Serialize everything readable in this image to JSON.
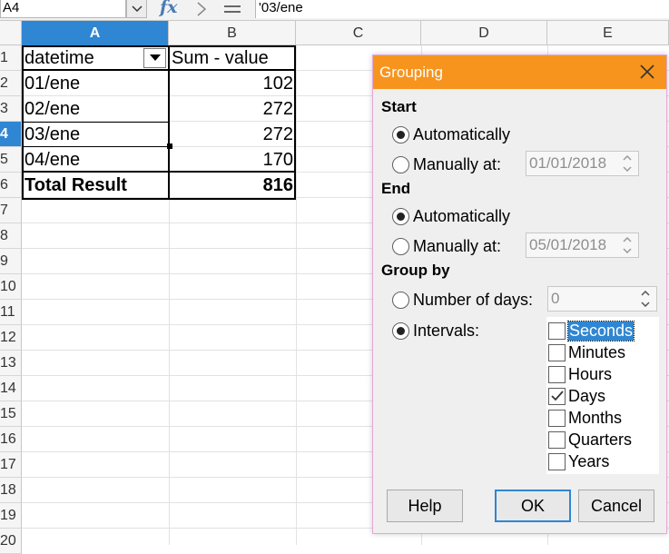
{
  "formula_bar": {
    "cell_ref": "A4",
    "formula": "'03/ene",
    "fx_label": "fx"
  },
  "columns": [
    "A",
    "B",
    "C",
    "D",
    "E"
  ],
  "rows": [
    "1",
    "2",
    "3",
    "4",
    "5",
    "6",
    "7",
    "8",
    "9",
    "10",
    "11",
    "12",
    "13",
    "14",
    "15",
    "16",
    "17",
    "18",
    "19",
    "20"
  ],
  "pivot": {
    "header_field": "datetime",
    "header_value": "Sum - value",
    "rows": [
      {
        "label": "01/ene",
        "value": "102"
      },
      {
        "label": "02/ene",
        "value": "272"
      },
      {
        "label": "03/ene",
        "value": "272"
      },
      {
        "label": "04/ene",
        "value": "170"
      }
    ],
    "total_label": "Total Result",
    "total_value": "816"
  },
  "dialog": {
    "title": "Grouping",
    "start": {
      "heading": "Start",
      "auto_label": "Automatically",
      "manual_label": "Manually at:",
      "manual_value": "01/01/2018"
    },
    "end": {
      "heading": "End",
      "auto_label": "Automatically",
      "manual_label": "Manually at:",
      "manual_value": "05/01/2018"
    },
    "group_by": {
      "heading": "Group by",
      "days_label": "Number of days:",
      "days_value": "0",
      "intervals_label": "Intervals:",
      "intervals": [
        {
          "label": "Seconds",
          "checked": false,
          "selected": true
        },
        {
          "label": "Minutes",
          "checked": false,
          "selected": false
        },
        {
          "label": "Hours",
          "checked": false,
          "selected": false
        },
        {
          "label": "Days",
          "checked": true,
          "selected": false
        },
        {
          "label": "Months",
          "checked": false,
          "selected": false
        },
        {
          "label": "Quarters",
          "checked": false,
          "selected": false
        },
        {
          "label": "Years",
          "checked": false,
          "selected": false
        }
      ]
    },
    "buttons": {
      "help": "Help",
      "ok": "OK",
      "cancel": "Cancel"
    }
  },
  "colors": {
    "titlebar": "#f7941e",
    "selection": "#2f86d2",
    "dialog_bg": "#efefef"
  }
}
